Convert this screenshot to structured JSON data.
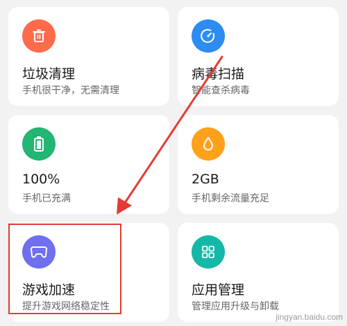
{
  "cards": [
    {
      "title": "垃圾清理",
      "subtitle": "手机很干净，无需清理",
      "icon": "trash-icon",
      "color": "#ff6b4a"
    },
    {
      "title": "病毒扫描",
      "subtitle": "智能查杀病毒",
      "icon": "gauge-icon",
      "color": "#2d8cf0"
    },
    {
      "title": "100%",
      "subtitle": "手机已充满",
      "icon": "battery-icon",
      "color": "#22b573"
    },
    {
      "title": "2GB",
      "subtitle": "手机剩余流量充足",
      "icon": "droplet-icon",
      "color": "#ffa11a"
    },
    {
      "title": "游戏加速",
      "subtitle": "提升游戏网络稳定性",
      "icon": "gamepad-icon",
      "color": "#6f6ff0"
    },
    {
      "title": "应用管理",
      "subtitle": "管理应用升级与卸载",
      "icon": "apps-grid-icon",
      "color": "#14b8a6"
    }
  ],
  "annotation": {
    "highlight_color": "#e53935"
  },
  "watermark": "jingyan.baidu.com"
}
